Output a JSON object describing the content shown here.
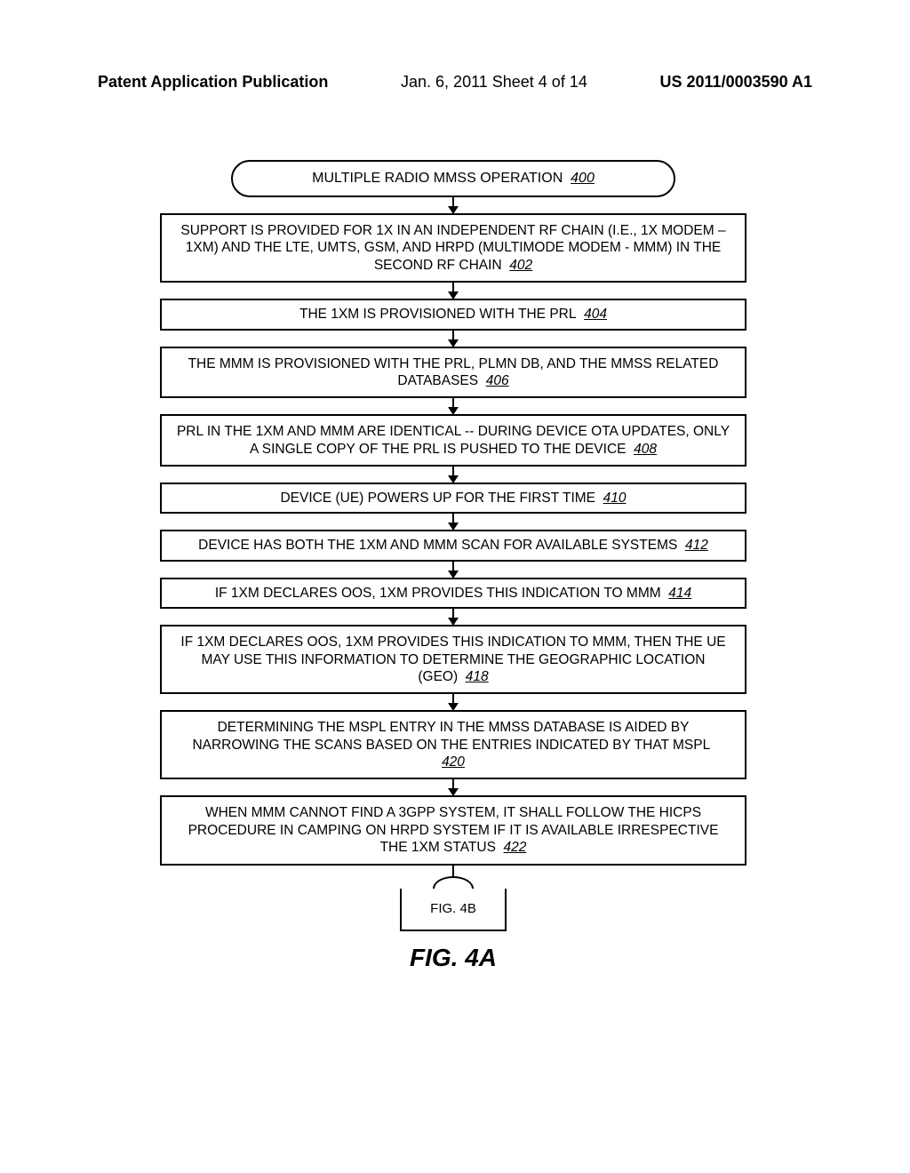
{
  "header": {
    "left": "Patent Application Publication",
    "mid": "Jan. 6, 2011  Sheet 4 of 14",
    "right": "US 2011/0003590 A1"
  },
  "title": {
    "text": "MULTIPLE RADIO MMSS OPERATION",
    "ref": "400"
  },
  "steps": [
    {
      "text": "SUPPORT IS PROVIDED FOR 1X IN AN INDEPENDENT RF CHAIN (I.E., 1X MODEM – 1XM) AND THE LTE, UMTS, GSM, AND HRPD (MULTIMODE MODEM - MMM) IN THE SECOND RF CHAIN",
      "ref": "402"
    },
    {
      "text": "THE 1XM IS PROVISIONED WITH THE PRL",
      "ref": "404"
    },
    {
      "text": "THE MMM IS PROVISIONED WITH THE PRL, PLMN DB, AND THE MMSS RELATED DATABASES",
      "ref": "406"
    },
    {
      "text": "PRL IN THE 1XM AND MMM ARE IDENTICAL -- DURING DEVICE OTA UPDATES, ONLY A SINGLE COPY OF THE PRL IS PUSHED TO THE DEVICE",
      "ref": "408"
    },
    {
      "text": "DEVICE (UE) POWERS UP FOR THE FIRST TIME",
      "ref": "410"
    },
    {
      "text": "DEVICE HAS BOTH THE 1XM AND MMM SCAN FOR AVAILABLE SYSTEMS",
      "ref": "412"
    },
    {
      "text": "IF 1XM DECLARES OOS, 1XM PROVIDES THIS INDICATION TO MMM",
      "ref": "414"
    },
    {
      "text": "IF 1XM DECLARES OOS, 1XM PROVIDES THIS INDICATION TO MMM, THEN THE UE MAY USE THIS INFORMATION TO DETERMINE THE GEOGRAPHIC LOCATION (GEO)",
      "ref": "418"
    },
    {
      "text": "DETERMINING THE MSPL ENTRY IN THE MMSS DATABASE IS AIDED BY NARROWING THE SCANS BASED ON THE ENTRIES INDICATED BY THAT MSPL",
      "ref": "420"
    },
    {
      "text": "WHEN MMM CANNOT FIND A 3GPP SYSTEM, IT SHALL FOLLOW THE HICPS PROCEDURE IN CAMPING ON HRPD SYSTEM IF IT IS AVAILABLE IRRESPECTIVE THE 1XM STATUS",
      "ref": "422"
    }
  ],
  "connector": {
    "label": "FIG. 4B"
  },
  "figcaption": "FIG. 4A"
}
